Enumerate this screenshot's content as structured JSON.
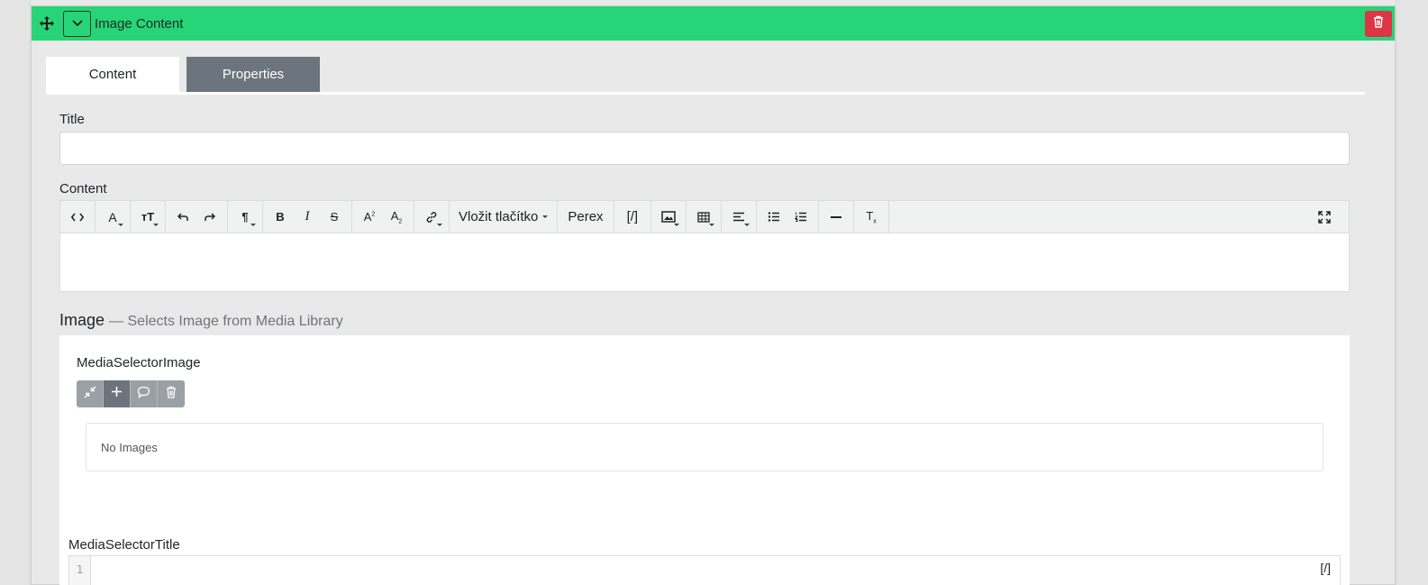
{
  "header": {
    "title": "Image Content"
  },
  "tabs": [
    {
      "label": "Content"
    },
    {
      "label": "Properties"
    }
  ],
  "form": {
    "title_label": "Title",
    "title_value": "",
    "content_label": "Content"
  },
  "toolbar": {
    "insert_button_label": "Vložit tlačítko",
    "perex_label": "Perex",
    "shortcode_label": "[/]"
  },
  "image_section": {
    "heading": "Image",
    "subheading": "— Selects Image from Media Library",
    "selector_label": "MediaSelectorImage",
    "empty_text": "No Images",
    "title_label": "MediaSelectorTitle",
    "line_number": "1",
    "code_tag": "[/]"
  },
  "colors": {
    "header": "#27d477",
    "delete": "#dc3545",
    "tab_active_bg": "#6c757d"
  }
}
